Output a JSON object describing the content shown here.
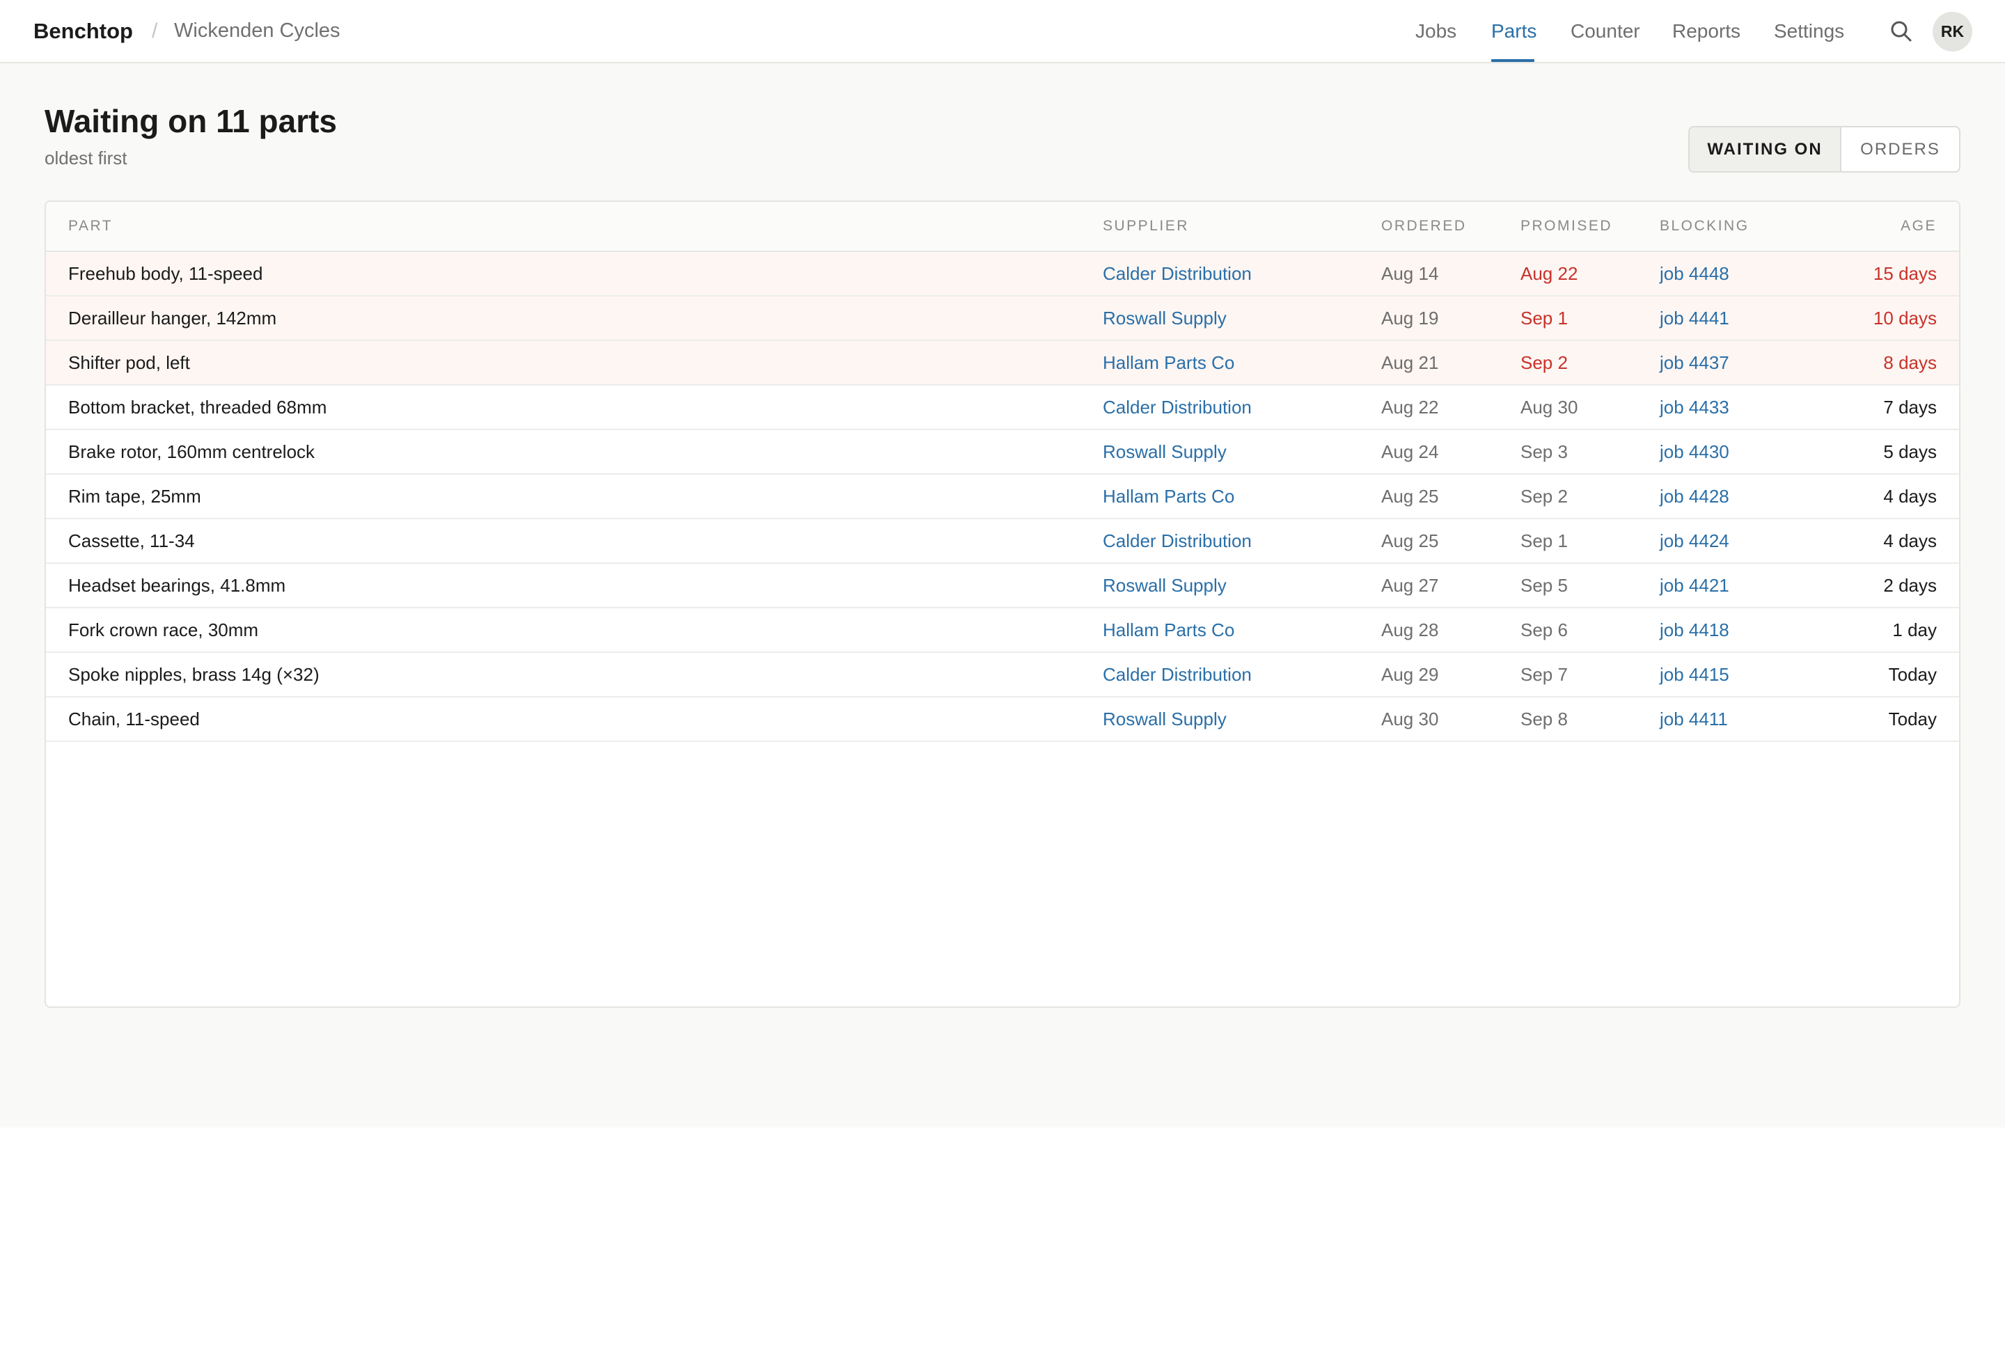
{
  "header": {
    "brand": "Benchtop",
    "separator": "/",
    "workspace": "Wickenden Cycles",
    "nav": [
      {
        "label": "Jobs",
        "active": false
      },
      {
        "label": "Parts",
        "active": true
      },
      {
        "label": "Counter",
        "active": false
      },
      {
        "label": "Reports",
        "active": false
      },
      {
        "label": "Settings",
        "active": false
      }
    ],
    "search_icon": "search-icon",
    "avatar_initials": "RK"
  },
  "page": {
    "title": "Waiting on 11 parts",
    "subtitle": "oldest first",
    "toggle": {
      "options": [
        "WAITING ON",
        "ORDERS"
      ],
      "selected": "WAITING ON"
    }
  },
  "table": {
    "columns": [
      "PART",
      "SUPPLIER",
      "ORDERED",
      "PROMISED",
      "BLOCKING",
      "AGE"
    ],
    "rows": [
      {
        "part": "Freehub body, 11-speed",
        "supplier": "Calder Distribution",
        "ordered": "Aug 14",
        "promised": "Aug 22",
        "blocking": "job 4448",
        "age": "15 days",
        "overdue": true
      },
      {
        "part": "Derailleur hanger, 142mm",
        "supplier": "Roswall Supply",
        "ordered": "Aug 19",
        "promised": "Sep 1",
        "blocking": "job 4441",
        "age": "10 days",
        "overdue": true
      },
      {
        "part": "Shifter pod, left",
        "supplier": "Hallam Parts Co",
        "ordered": "Aug 21",
        "promised": "Sep 2",
        "blocking": "job 4437",
        "age": "8 days",
        "overdue": true
      },
      {
        "part": "Bottom bracket, threaded 68mm",
        "supplier": "Calder Distribution",
        "ordered": "Aug 22",
        "promised": "Aug 30",
        "blocking": "job 4433",
        "age": "7 days",
        "overdue": false
      },
      {
        "part": "Brake rotor, 160mm centrelock",
        "supplier": "Roswall Supply",
        "ordered": "Aug 24",
        "promised": "Sep 3",
        "blocking": "job 4430",
        "age": "5 days",
        "overdue": false
      },
      {
        "part": "Rim tape, 25mm",
        "supplier": "Hallam Parts Co",
        "ordered": "Aug 25",
        "promised": "Sep 2",
        "blocking": "job 4428",
        "age": "4 days",
        "overdue": false
      },
      {
        "part": "Cassette, 11-34",
        "supplier": "Calder Distribution",
        "ordered": "Aug 25",
        "promised": "Sep 1",
        "blocking": "job 4424",
        "age": "4 days",
        "overdue": false
      },
      {
        "part": "Headset bearings, 41.8mm",
        "supplier": "Roswall Supply",
        "ordered": "Aug 27",
        "promised": "Sep 5",
        "blocking": "job 4421",
        "age": "2 days",
        "overdue": false
      },
      {
        "part": "Fork crown race, 30mm",
        "supplier": "Hallam Parts Co",
        "ordered": "Aug 28",
        "promised": "Sep 6",
        "blocking": "job 4418",
        "age": "1 day",
        "overdue": false
      },
      {
        "part": "Spoke nipples, brass 14g (×32)",
        "supplier": "Calder Distribution",
        "ordered": "Aug 29",
        "promised": "Sep 7",
        "blocking": "job 4415",
        "age": "Today",
        "overdue": false
      },
      {
        "part": "Chain, 11-speed",
        "supplier": "Roswall Supply",
        "ordered": "Aug 30",
        "promised": "Sep 8",
        "blocking": "job 4411",
        "age": "Today",
        "overdue": false
      }
    ]
  },
  "colors": {
    "accent": "#2a6fa8",
    "overdue_text": "#c8322a",
    "overdue_row_bg": "#fdf6f3",
    "page_bg": "#f9f9f7"
  }
}
